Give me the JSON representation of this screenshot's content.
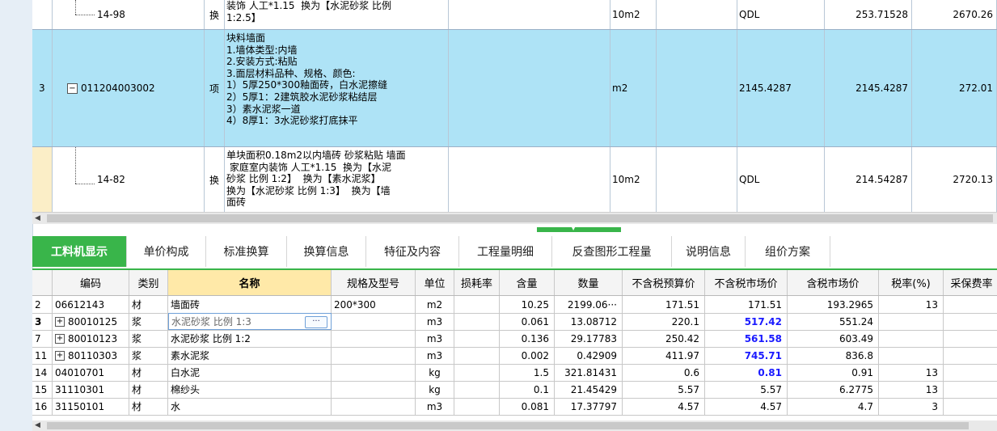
{
  "upper_rows": [
    {
      "idx": "",
      "code": "14-98",
      "type": "换",
      "desc": "装饰 人工*1.15  换为【水泥砂浆 比例\n1:2.5】",
      "unit": "10m2",
      "qdl": "QDL",
      "q2": "253.71528",
      "q3": "2670.26"
    },
    {
      "idx": "3",
      "code": "011204003002",
      "type": "项",
      "desc": "块料墙面\n1.墙体类型:内墙\n2.安装方式:粘贴\n3.面层材料品种、规格、颜色:\n1）5厚250*300釉面砖，白水泥擦缝\n2）5厚1：2建筑胶水泥砂浆粘结层\n3）素水泥浆一道\n4）8厚1：3水泥砂浆打底抹平",
      "unit": "m2",
      "qdl": "2145.4287",
      "q2": "2145.4287",
      "q3": "272.01"
    },
    {
      "idx": "",
      "code": "14-82",
      "type": "换",
      "desc": "单块面积0.18m2以内墙砖 砂浆粘贴 墙面\n 家庭室内装饰 人工*1.15  换为【水泥\n砂浆 比例 1:2】  换为【素水泥浆】\n换为【水泥砂浆 比例 1:3】  换为【墙\n面砖",
      "unit": "10m2",
      "qdl": "QDL",
      "q2": "214.54287",
      "q3": "2720.13"
    }
  ],
  "tabs": [
    "工料机显示",
    "单价构成",
    "标准换算",
    "换算信息",
    "特征及内容",
    "工程量明细",
    "反查图形工程量",
    "说明信息",
    "组价方案"
  ],
  "columns": [
    "编码",
    "类别",
    "名称",
    "规格及型号",
    "单位",
    "损耗率",
    "含量",
    "数量",
    "不含税预算价",
    "不含税市场价",
    "含税市场价",
    "税率(%)",
    "采保费率"
  ],
  "rows": [
    {
      "no": "2",
      "code": "06612143",
      "expand": false,
      "cat": "材",
      "name": "墙面砖",
      "spec": "200*300",
      "unit": "m2",
      "loss": "",
      "content": "10.25",
      "qty": "2199.06···",
      "budget": "171.51",
      "market": "171.51",
      "market_blue": false,
      "taxed": "193.2965",
      "tax": "13"
    },
    {
      "no": "3",
      "code": "80010125",
      "expand": true,
      "cat": "浆",
      "name": "水泥砂浆 比例 1:3",
      "spec": "",
      "unit": "m3",
      "loss": "",
      "content": "0.061",
      "qty": "13.08712",
      "budget": "220.1",
      "market": "517.42",
      "market_blue": true,
      "taxed": "551.24",
      "tax": ""
    },
    {
      "no": "7",
      "code": "80010123",
      "expand": true,
      "cat": "浆",
      "name": "水泥砂浆 比例 1:2",
      "spec": "",
      "unit": "m3",
      "loss": "",
      "content": "0.136",
      "qty": "29.17783",
      "budget": "250.42",
      "market": "561.58",
      "market_blue": true,
      "taxed": "603.49",
      "tax": ""
    },
    {
      "no": "11",
      "code": "80110303",
      "expand": true,
      "cat": "浆",
      "name": "素水泥浆",
      "spec": "",
      "unit": "m3",
      "loss": "",
      "content": "0.002",
      "qty": "0.42909",
      "budget": "411.97",
      "market": "745.71",
      "market_blue": true,
      "taxed": "836.8",
      "tax": ""
    },
    {
      "no": "14",
      "code": "04010701",
      "expand": false,
      "cat": "材",
      "name": "白水泥",
      "spec": "",
      "unit": "kg",
      "loss": "",
      "content": "1.5",
      "qty": "321.81431",
      "budget": "0.6",
      "market": "0.81",
      "market_blue": true,
      "taxed": "0.91",
      "tax": "13"
    },
    {
      "no": "15",
      "code": "31110301",
      "expand": false,
      "cat": "材",
      "name": "棉纱头",
      "spec": "",
      "unit": "kg",
      "loss": "",
      "content": "0.1",
      "qty": "21.45429",
      "budget": "5.57",
      "market": "5.57",
      "market_blue": false,
      "taxed": "6.2775",
      "tax": "13"
    },
    {
      "no": "16",
      "code": "31150101",
      "expand": false,
      "cat": "材",
      "name": "水",
      "spec": "",
      "unit": "m3",
      "loss": "",
      "content": "0.081",
      "qty": "17.37797",
      "budget": "4.57",
      "market": "4.57",
      "market_blue": false,
      "taxed": "4.7",
      "tax": "3"
    }
  ],
  "editing_button": "···",
  "tree_expand_symbol": "−",
  "row_expand_symbol": "+",
  "scroll_left_symbol": "◀",
  "splitter_symbol": "▼",
  "colors": {
    "selected_row": "#aee3f6",
    "tab_active": "#39b54a",
    "blue_value": "#1a1aff",
    "name_header": "#ffe9a8"
  }
}
